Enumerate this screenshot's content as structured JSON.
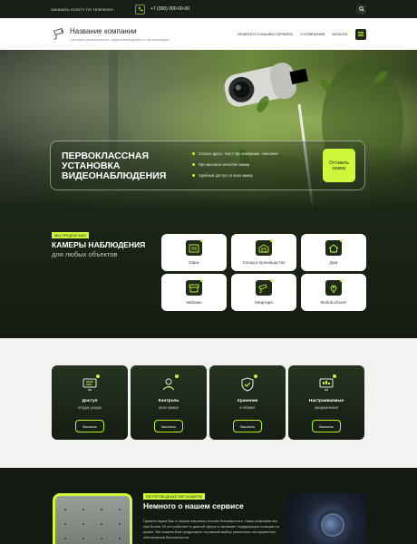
{
  "topbar": {
    "order_label": "Заказать услугу по телефону",
    "phone": "+7 (000) 000-00-00"
  },
  "header": {
    "company_name": "Название компании",
    "tagline": "Системы безопасности, видеонаблюдения и сигнализации",
    "nav": [
      "Немного о нашем сервисе",
      "О компании",
      "Каталог"
    ]
  },
  "hero": {
    "title": "Первоклассная установка видеонаблюдения",
    "bullets": [
      "Слоган здесь: текст про компанию, описание",
      "Про высокое качество камер",
      "Удобный доступ со всех камер"
    ],
    "cta_label": "Оставить заявку"
  },
  "offers": {
    "tag": "Мы предлагаем",
    "title": "Камеры наблюдения",
    "subtitle": "для любых объектов",
    "cards": [
      {
        "label": "Офис",
        "icon": "office-icon"
      },
      {
        "label": "Склад и производство",
        "icon": "warehouse-icon"
      },
      {
        "label": "Дом",
        "icon": "house-icon"
      },
      {
        "label": "Магазин",
        "icon": "shop-icon"
      },
      {
        "label": "Квартира",
        "icon": "apartment-camera-icon"
      },
      {
        "label": "Любой объект",
        "icon": "location-pin-icon"
      }
    ]
  },
  "features": [
    {
      "title": "Доступ",
      "subtitle": "откуда угодно",
      "button": "Заказать",
      "icon": "monitor-icon"
    },
    {
      "title": "Контроль",
      "subtitle": "всех камер",
      "button": "Заказать",
      "icon": "person-control-icon"
    },
    {
      "title": "Хранение",
      "subtitle": "в облаке",
      "button": "Заказать",
      "icon": "shield-icon"
    },
    {
      "title": "Настраиваемые",
      "subtitle": "уведомления",
      "button": "Заказать",
      "icon": "settings-monitor-icon"
    }
  ],
  "about": {
    "tag": "Беспроводные WIFI-камеры",
    "title": "Немного о нашем сервисе",
    "text": "Приветствуем Вас в нашем магазине систем безопасности. Наша компания вот уже более 15 лет работает в данной сфере и занимает лидирующие позиции на рынке. Мы можем Вам предложить огромный выбор различных инструментов обеспечения безопасности."
  },
  "colors": {
    "accent": "#cdf83c",
    "dark": "#1c2616"
  }
}
